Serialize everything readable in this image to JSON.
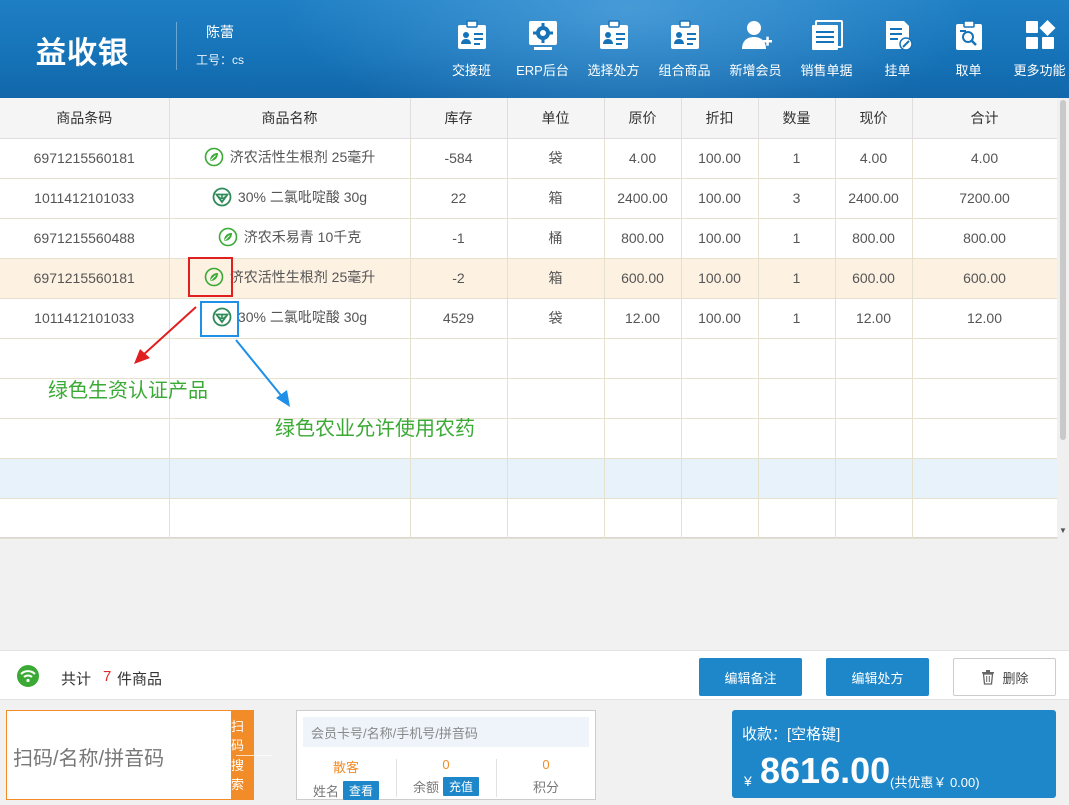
{
  "app": {
    "title": "益收银",
    "user_name": "陈蕾",
    "user_id": "工号：cs"
  },
  "toolbar": [
    {
      "label": "交接班",
      "icon": "shift-handover-icon"
    },
    {
      "label": "ERP后台",
      "icon": "gear-icon"
    },
    {
      "label": "选择处方",
      "icon": "prescription-icon"
    },
    {
      "label": "组合商品",
      "icon": "combo-icon"
    },
    {
      "label": "新增会员",
      "icon": "add-user-icon"
    },
    {
      "label": "销售单据",
      "icon": "sales-doc-icon"
    },
    {
      "label": "挂单",
      "icon": "hold-order-icon"
    },
    {
      "label": "取单",
      "icon": "retrieve-order-icon"
    },
    {
      "label": "更多功能",
      "icon": "more-icon"
    }
  ],
  "table": {
    "headers": [
      "商品条码",
      "商品名称",
      "库存",
      "单位",
      "原价",
      "折扣",
      "数量",
      "现价",
      "合计"
    ],
    "rows": [
      {
        "barcode": "6971215560181",
        "name": "济农活性生根剂 25毫升",
        "badge": "green-input",
        "stock": "-584",
        "unit": "袋",
        "price": "4.00",
        "discount": "100.00",
        "qty": "1",
        "now": "4.00",
        "total": "4.00"
      },
      {
        "barcode": "1011412101033",
        "name": "30% 二氯吡啶酸 30g",
        "badge": "green-agri",
        "stock": "22",
        "unit": "箱",
        "price": "2400.00",
        "discount": "100.00",
        "qty": "3",
        "now": "2400.00",
        "total": "7200.00"
      },
      {
        "barcode": "6971215560488",
        "name": "济农禾易青 10千克",
        "badge": "green-input",
        "stock": "-1",
        "unit": "桶",
        "price": "800.00",
        "discount": "100.00",
        "qty": "1",
        "now": "800.00",
        "total": "800.00"
      },
      {
        "barcode": "6971215560181",
        "name": "济农活性生根剂 25毫升",
        "badge": "green-input",
        "stock": "-2",
        "unit": "箱",
        "price": "600.00",
        "discount": "100.00",
        "qty": "1",
        "now": "600.00",
        "total": "600.00"
      },
      {
        "barcode": "1011412101033",
        "name": "30% 二氯吡啶酸 30g",
        "badge": "green-agri",
        "stock": "4529",
        "unit": "袋",
        "price": "12.00",
        "discount": "100.00",
        "qty": "1",
        "now": "12.00",
        "total": "12.00"
      }
    ],
    "selected_row": 3
  },
  "annotations": {
    "red_label": "绿色生资认证产品",
    "blue_label": "绿色农业允许使用农药",
    "red_color": "#e02020",
    "blue_color": "#1e90e8",
    "text_color": "#3aaa35"
  },
  "status": {
    "total_label": "共计",
    "total_count": "7",
    "total_unit": "件商品",
    "btn_edit_note": "编辑备注",
    "btn_edit_rx": "编辑处方",
    "btn_delete": "删除"
  },
  "scan": {
    "placeholder": "扫码/名称/拼音码",
    "btn_scan": "扫码",
    "btn_search": "搜索"
  },
  "member": {
    "placeholder": "会员卡号/名称/手机号/拼音码",
    "guest": "散客",
    "name_label": "姓名",
    "view_btn": "查看",
    "balance": "0",
    "balance_label": "余额",
    "recharge_btn": "充值",
    "points": "0",
    "points_label": "积分"
  },
  "payment": {
    "label": "收款：[空格键]",
    "currency": "¥",
    "amount": "8616.00",
    "discount_text": "(共优惠￥ 0.00)"
  },
  "colors": {
    "header": "#1673b8",
    "accent": "#1e87c9",
    "orange": "#f28c28",
    "green": "#3aaa35"
  }
}
